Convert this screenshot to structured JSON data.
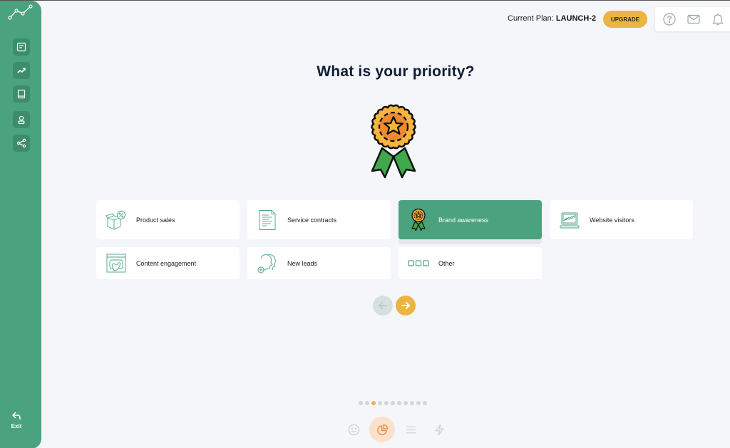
{
  "sidebar": {
    "logo": "line-chart-logo",
    "items": [
      {
        "name": "notes",
        "icon": "note-icon"
      },
      {
        "name": "trends",
        "icon": "trend-up-icon"
      },
      {
        "name": "book",
        "icon": "book-icon"
      },
      {
        "name": "profile",
        "icon": "user-icon"
      },
      {
        "name": "share",
        "icon": "share-icon"
      }
    ],
    "exit_label": "Exit"
  },
  "header": {
    "plan_label": "Current Plan:",
    "plan_name": "LAUNCH-2",
    "upgrade_label": "UPGRADE",
    "icons": [
      "help-icon",
      "mail-icon",
      "bell-icon"
    ]
  },
  "main": {
    "title": "What is your priority?",
    "hero_icon": "award-ribbon-icon",
    "options": [
      {
        "label": "Product sales",
        "icon": "box-discount-icon",
        "selected": false
      },
      {
        "label": "Service contracts",
        "icon": "document-icon",
        "selected": false
      },
      {
        "label": "Brand awareness",
        "icon": "award-ribbon-icon",
        "selected": true
      },
      {
        "label": "Website visitors",
        "icon": "laptop-chart-icon",
        "selected": false
      },
      {
        "label": "Content engagement",
        "icon": "browser-click-icon",
        "selected": false
      },
      {
        "label": "New leads",
        "icon": "people-add-icon",
        "selected": false
      },
      {
        "label": "Other",
        "icon": "three-squares-icon",
        "selected": false
      }
    ]
  },
  "navigation": {
    "prev_icon": "arrow-left-icon",
    "next_icon": "arrow-right-icon",
    "progress": {
      "total_steps": 11,
      "current_step": 3
    }
  },
  "step_icons": [
    {
      "icon": "smiley-icon",
      "active": false
    },
    {
      "icon": "pie-chart-icon",
      "active": true
    },
    {
      "icon": "menu-lines-icon",
      "active": false
    },
    {
      "icon": "lightning-icon",
      "active": false
    }
  ],
  "colors": {
    "brand_green": "#4aa27e",
    "accent_yellow": "#ecb443",
    "background": "#f4f6fa",
    "title": "#0f1d33"
  }
}
